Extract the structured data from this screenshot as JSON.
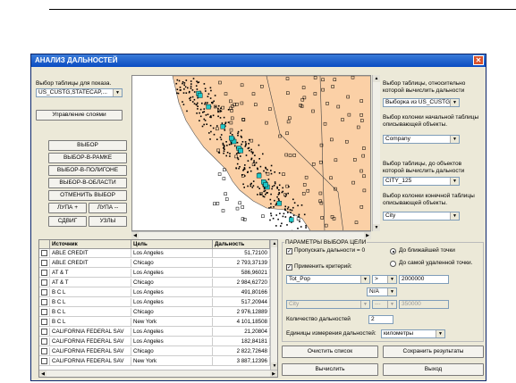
{
  "window": {
    "title": "АНАЛИЗ ДАЛЬНОСТЕЙ",
    "close_glyph": "✕"
  },
  "left": {
    "table_label": "Выбор таблицы для показа.",
    "table_value": "US_CUSTG,STATECAP,...",
    "manage_layers": "Управление слоями",
    "buttons": [
      "ВЫБОР",
      "ВЫБОР-В-РАМКЕ",
      "ВЫБОР-В-ПОЛИГОНЕ",
      "ВЫБОР-В-ОБЛАСТИ",
      "ОТМЕНИТЬ ВЫБОР"
    ],
    "zoom_in": "ЛУПА +",
    "zoom_out": "ЛУПА --",
    "pan": "СДВИГ",
    "nodes": "УЗЛЫ"
  },
  "right": {
    "source_table_label": "Выбор таблицы, относительно которой вычислить дальности",
    "source_table_value": "Выборка из US_CUSTG",
    "start_col_label": "Выбор колонки начальной таблицы описывающей объекты.",
    "start_col_value": "Company",
    "dest_table_label": "Выбор таблицы, до объектов которой вычислить дальности",
    "dest_table_value": "CITY_125",
    "end_col_label": "Выбор колонки конечной таблицы описывающей объекты.",
    "end_col_value": "City"
  },
  "grid": {
    "headers": [
      "Источник",
      "Цель",
      "Дальность"
    ],
    "rows": [
      [
        "ABLE CREDIT",
        "Los Angeles",
        "51,72100"
      ],
      [
        "ABLE CREDIT",
        "Chicago",
        "2 793,37139"
      ],
      [
        "AT & T",
        "Los Angeles",
        "586,96021"
      ],
      [
        "AT & T",
        "Chicago",
        "2 984,62720"
      ],
      [
        "B C L",
        "Los Angeles",
        "491,80166"
      ],
      [
        "B C L",
        "Los Angeles",
        "517,20944"
      ],
      [
        "B C L",
        "Chicago",
        "2 976,12889"
      ],
      [
        "B C L",
        "New York",
        "4 101,18508"
      ],
      [
        "CALIFORNIA FEDERAL SAV",
        "Los Angeles",
        "21,20804"
      ],
      [
        "CALIFORNIA FEDERAL SAV",
        "Los Angeles",
        "182,84181"
      ],
      [
        "CALIFORNIA FEDERAL SAV",
        "Chicago",
        "2 822,72648"
      ],
      [
        "CALIFORNIA FEDERAL SAV",
        "New York",
        "3 887,12396"
      ]
    ]
  },
  "params": {
    "title": "ПАРАМЕТРЫ ВЫБОРА ЦЕЛИ",
    "skip_zero": "Пропускать дальности = 0",
    "nearest": "До ближайшей точки",
    "farthest": "До самой удаленной точки.",
    "apply_criteria": "Применить критерий:",
    "field1": "Tot_Pop",
    "op1": ">",
    "value1": "2000000",
    "logic": "N/A",
    "field2": "City",
    "op2": "---",
    "value2": "350000",
    "count_label": "Количество дальностей",
    "count_value": "2",
    "units_label": "Единицы измерения дальностей:",
    "units_value": "километры"
  },
  "actions": {
    "clear": "Очистить список",
    "save": "Сохранить результаты",
    "compute": "Вычислить",
    "exit": "Выход"
  }
}
